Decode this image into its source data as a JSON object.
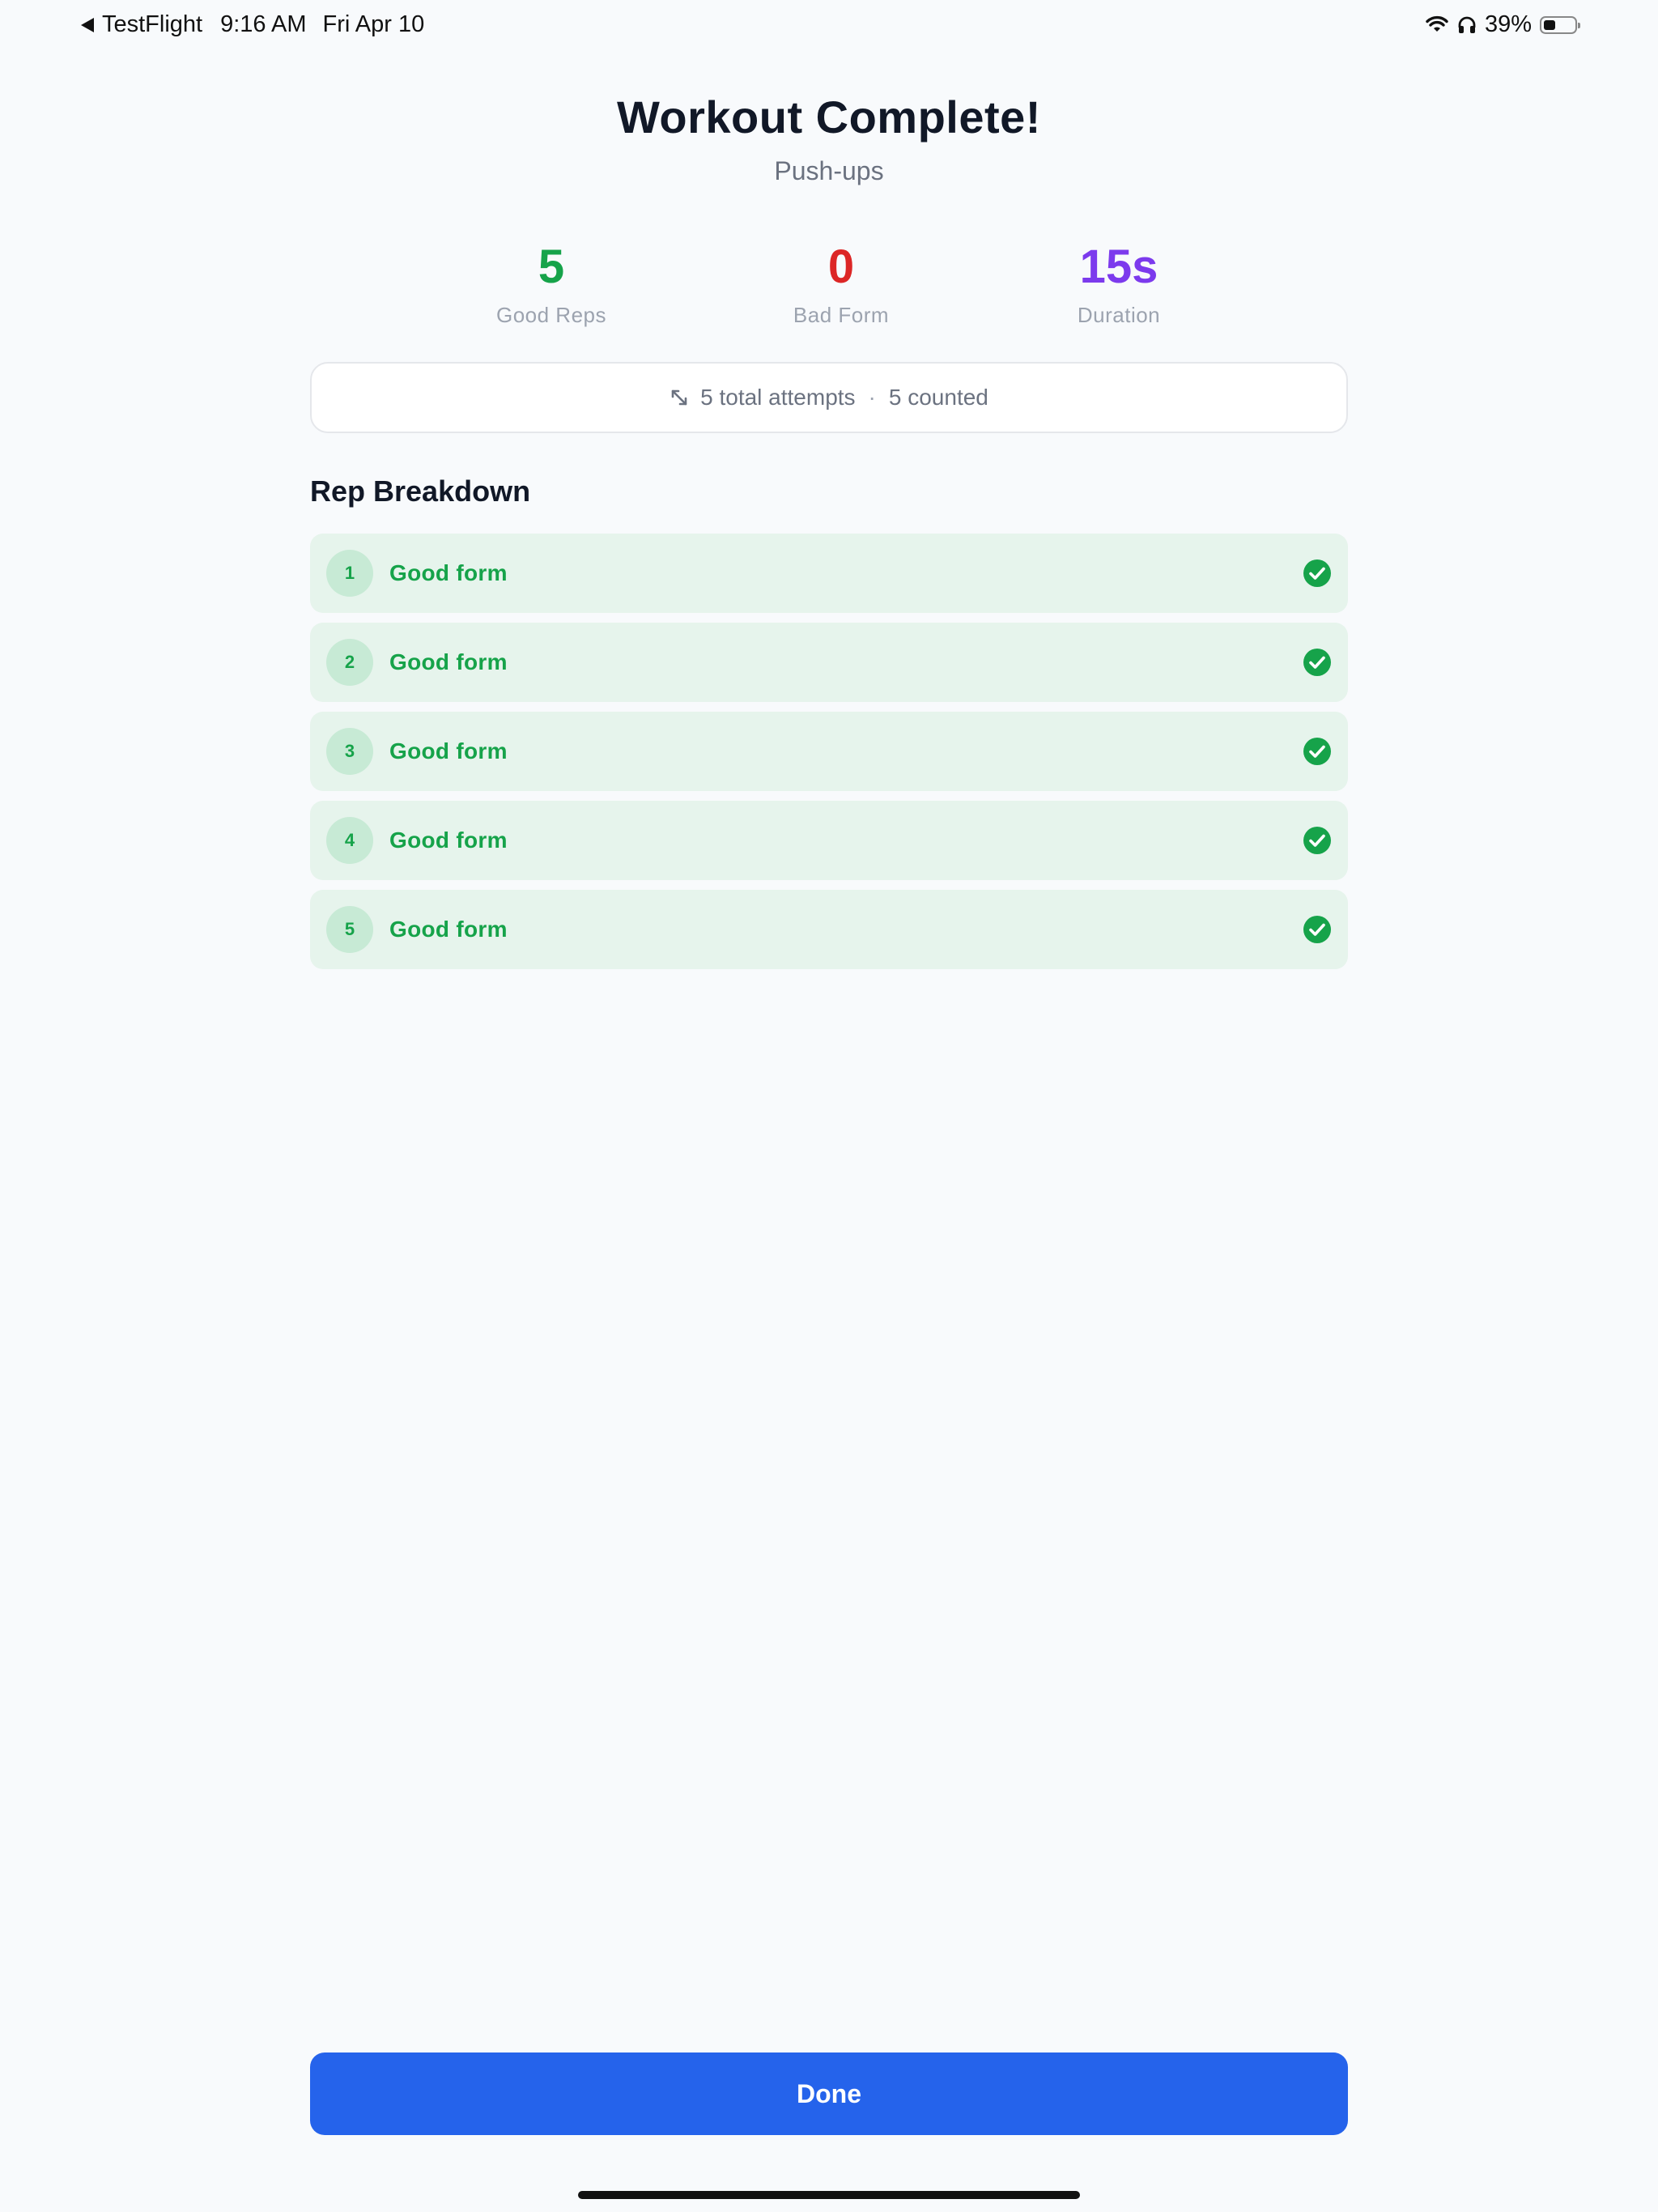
{
  "status_bar": {
    "back_app": "TestFlight",
    "time": "9:16 AM",
    "date": "Fri Apr 10",
    "battery_percent": "39%",
    "battery_level": 0.39,
    "icons": [
      "wifi-icon",
      "headphones-icon",
      "battery-icon"
    ]
  },
  "header": {
    "title": "Workout Complete!",
    "subtitle": "Push-ups"
  },
  "stats": [
    {
      "value": "5",
      "label": "Good Reps",
      "color": "#16a34a"
    },
    {
      "value": "0",
      "label": "Bad Form",
      "color": "#dc2626"
    },
    {
      "value": "15s",
      "label": "Duration",
      "color": "#7c3aed"
    }
  ],
  "attempts": {
    "icon": "arrows-diagonal-icon",
    "total": "5 total attempts",
    "separator": "·",
    "counted": "5 counted"
  },
  "breakdown": {
    "title": "Rep Breakdown",
    "reps": [
      {
        "number": "1",
        "label": "Good form",
        "status": "good"
      },
      {
        "number": "2",
        "label": "Good form",
        "status": "good"
      },
      {
        "number": "3",
        "label": "Good form",
        "status": "good"
      },
      {
        "number": "4",
        "label": "Good form",
        "status": "good"
      },
      {
        "number": "5",
        "label": "Good form",
        "status": "good"
      }
    ]
  },
  "actions": {
    "done_label": "Done"
  },
  "colors": {
    "good": "#16a34a",
    "good_bg": "#e6f4ec",
    "primary": "#2563eb"
  }
}
